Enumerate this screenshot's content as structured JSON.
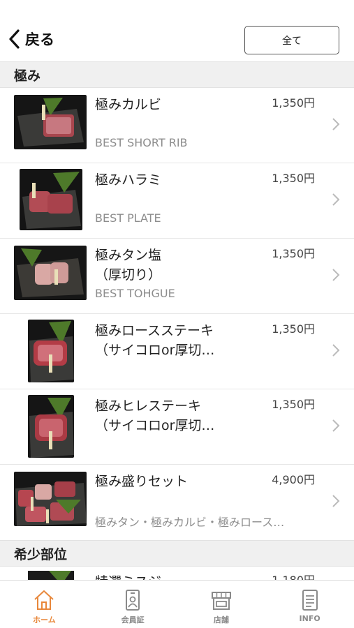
{
  "header": {
    "back_label": "戻る",
    "all_label": "全て"
  },
  "sections": [
    {
      "title": "極み"
    },
    {
      "title": "希少部位"
    }
  ],
  "items": [
    {
      "name_line1": "極みカルビ",
      "name_line2": "",
      "price": "1,350円",
      "sub": "BEST SHORT RIB"
    },
    {
      "name_line1": "極みハラミ",
      "name_line2": "",
      "price": "1,350円",
      "sub": "BEST PLATE"
    },
    {
      "name_line1": "極みタン塩",
      "name_line2": "（厚切り）",
      "price": "1,350円",
      "sub": "BEST TOHGUE"
    },
    {
      "name_line1": "極みロースステーキ",
      "name_line2": "（サイコロor厚切…",
      "price": "1,350円",
      "sub": ""
    },
    {
      "name_line1": "極みヒレステーキ",
      "name_line2": "（サイコロor厚切…",
      "price": "1,350円",
      "sub": ""
    },
    {
      "name_line1": "極み盛りセット",
      "name_line2": "",
      "price": "4,900円",
      "sub": "極みタン・極みカルビ・極みロース…"
    },
    {
      "name_line1": "特選ミスジ",
      "name_line2": "",
      "price": "1,180円",
      "sub": ""
    }
  ],
  "tabbar": {
    "tabs": [
      {
        "label": "ホーム",
        "icon": "home-icon",
        "active": true
      },
      {
        "label": "会員証",
        "icon": "member-card-icon",
        "active": false
      },
      {
        "label": "店舗",
        "icon": "store-icon",
        "active": false
      },
      {
        "label": "INFO",
        "icon": "info-document-icon",
        "active": false
      }
    ]
  },
  "colors": {
    "accent": "#e8873a",
    "section_bg": "#f0f0f0",
    "sub_text": "#8d8d8d"
  }
}
